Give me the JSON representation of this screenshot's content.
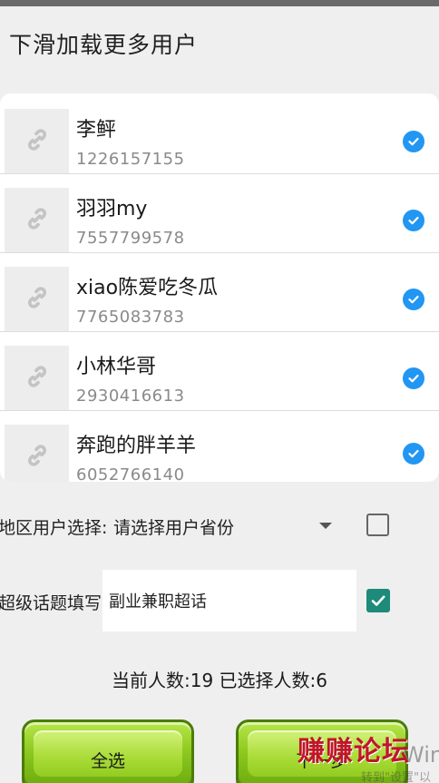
{
  "app": {
    "title": "下滑加载更多用户"
  },
  "users": [
    {
      "name": "李鲆",
      "id": "1226157155",
      "selected": true
    },
    {
      "name": "羽羽my",
      "id": "7557799578",
      "selected": true
    },
    {
      "name": "xiao陈爱吃冬瓜",
      "id": "7765083783",
      "selected": true
    },
    {
      "name": "小林华哥",
      "id": "2930416613",
      "selected": true
    },
    {
      "name": "奔跑的胖羊羊",
      "id": "6052766140",
      "selected": true
    }
  ],
  "icons": {
    "avatar_placeholder": "link-icon",
    "selected_mark": "check-circle-icon",
    "dropdown": "triangle-down-icon"
  },
  "region": {
    "label": "地区用户选择:",
    "select_placeholder": "请选择用户省份",
    "checked": false
  },
  "topic": {
    "label": "超级话题填写:",
    "value": "副业兼职超话",
    "checked": true
  },
  "counts": {
    "text": "当前人数:19 已选择人数:6"
  },
  "buttons": {
    "select_all": "全选",
    "next": "下一步"
  },
  "overlays": {
    "watermark": "赚赚论坛",
    "win_text": "Win",
    "settings_text": "转到\"设置\"以"
  },
  "colors": {
    "check_blue": "#2196f3",
    "checkbox_teal": "#1e8a7a",
    "button_green": "#8cc81e",
    "watermark_red": "#c0162a"
  }
}
